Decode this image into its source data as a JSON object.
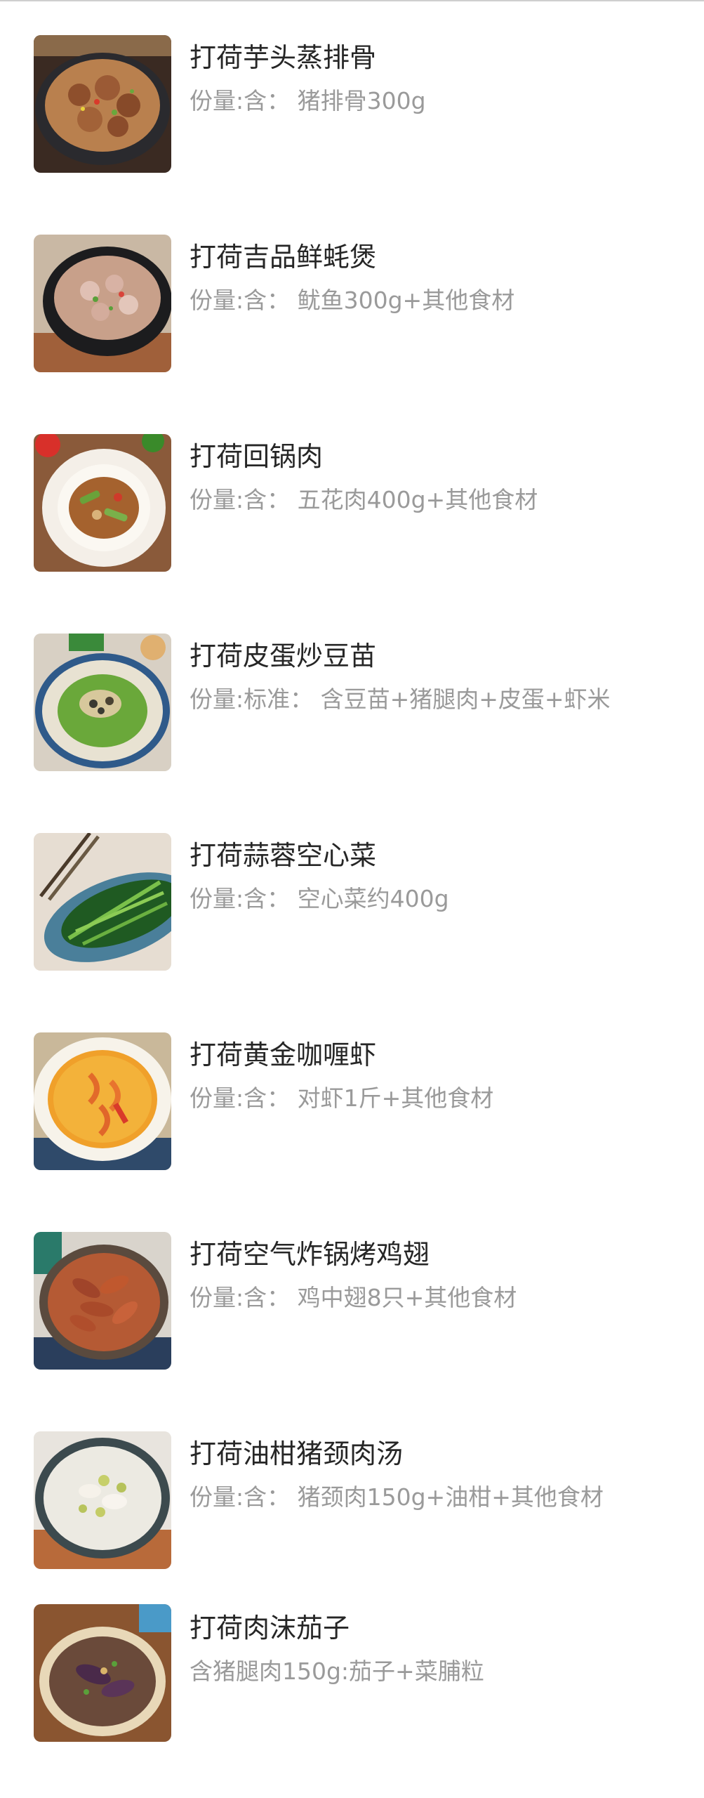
{
  "items": [
    {
      "title": "打荷芋头蒸排骨",
      "subtitle": "份量:含：  猪排骨300g",
      "image": "steamed-pork-ribs-taro-photo"
    },
    {
      "title": "打荷吉品鲜蚝煲",
      "subtitle": "份量:含：  鱿鱼300g+其他食材",
      "image": "oyster-claypot-photo"
    },
    {
      "title": "打荷回锅肉",
      "subtitle": "份量:含：  五花肉400g+其他食材",
      "image": "twice-cooked-pork-photo"
    },
    {
      "title": "打荷皮蛋炒豆苗",
      "subtitle": "份量:标准：  含豆苗+猪腿肉+皮蛋+虾米",
      "image": "pea-shoots-century-egg-photo"
    },
    {
      "title": "打荷蒜蓉空心菜",
      "subtitle": "份量:含：  空心菜约400g",
      "image": "garlic-water-spinach-photo"
    },
    {
      "title": "打荷黄金咖喱虾",
      "subtitle": "份量:含：  对虾1斤+其他食材",
      "image": "golden-curry-shrimp-photo"
    },
    {
      "title": "打荷空气炸锅烤鸡翅",
      "subtitle": "份量:含：  鸡中翅8只+其他食材",
      "image": "air-fryer-chicken-wings-photo"
    },
    {
      "title": "打荷油柑猪颈肉汤",
      "subtitle": "份量:含：  猪颈肉150g+油柑+其他食材",
      "image": "pork-neck-soup-photo"
    },
    {
      "title": "打荷肉沫茄子",
      "subtitle": "含猪腿肉150g:茄子+菜脯粒",
      "image": "minced-pork-eggplant-photo"
    }
  ]
}
